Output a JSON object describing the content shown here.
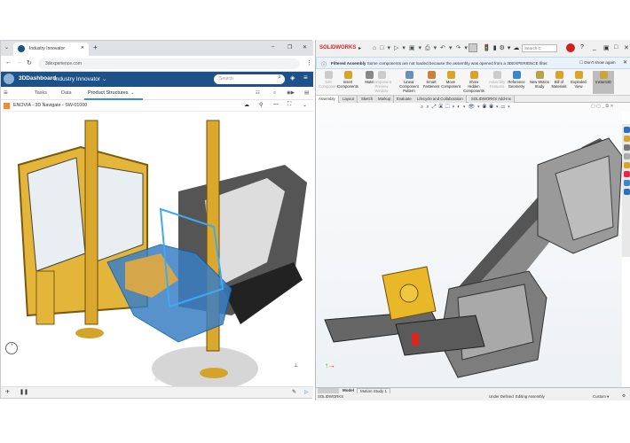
{
  "browser": {
    "tab_title": "Industry Innovator",
    "url": "3dexperience.com",
    "new_tab": "+",
    "window_controls": [
      "–",
      "❐",
      "✕"
    ]
  },
  "dashboard": {
    "brand": "3DDashboard",
    "app": "Industry Innovator",
    "search_placeholder": "Search",
    "tabs": [
      "Tasks",
      "Data",
      "Product Structures"
    ],
    "active_tab": "Product Structures",
    "panel_title": "ENOVIA - 3D Navigate - SW-01000",
    "accent": "#1d5288"
  },
  "solidworks": {
    "logo": "SOLIDWORKS",
    "search_placeholder": "Search C",
    "info_title": "Filtered Assembly",
    "info_text": "Some components are not loaded because the assembly was opened from a 3DEXPERIENCE filter.",
    "dont_show": "Don't show again",
    "ribbon": [
      {
        "label": "Edit Component",
        "disabled": true,
        "color": "#ccc"
      },
      {
        "label": "Insert Components",
        "disabled": false,
        "color": "#d9a42a"
      },
      {
        "label": "Mate",
        "disabled": false,
        "color": "#888"
      },
      {
        "label": "Component Preview Window",
        "disabled": true,
        "color": "#ccc"
      },
      {
        "label": "Linear Component Pattern",
        "disabled": false,
        "color": "#6b8fb8"
      },
      {
        "label": "Smart Fasteners",
        "disabled": false,
        "color": "#c9823a"
      },
      {
        "label": "Move Component",
        "disabled": false,
        "color": "#d9a42a"
      },
      {
        "label": "Show Hidden Components",
        "disabled": false,
        "color": "#d9a42a"
      },
      {
        "label": "Assembly Features",
        "disabled": true,
        "color": "#ccc"
      },
      {
        "label": "Reference Geometry",
        "disabled": false,
        "color": "#3a88c9"
      },
      {
        "label": "New Motion Study",
        "disabled": false,
        "color": "#b9a24a"
      },
      {
        "label": "Bill of Materials",
        "disabled": false,
        "color": "#d9a42a"
      },
      {
        "label": "Exploded View",
        "disabled": false,
        "color": "#d9a42a"
      },
      {
        "label": "Instant3D",
        "disabled": false,
        "color": "#c9a63a"
      }
    ],
    "tabs": [
      "Assembly",
      "Layout",
      "Sketch",
      "Markup",
      "Evaluate",
      "Lifecycle and Collaboration",
      "SOLIDWORKS Add-Ins"
    ],
    "bottom_tabs": [
      "Model",
      "Motion Study 1"
    ],
    "status": {
      "app": "SOLIDWORKS",
      "state": "Under Defined",
      "mode": "Editing Assembly",
      "units": "Custom"
    }
  }
}
